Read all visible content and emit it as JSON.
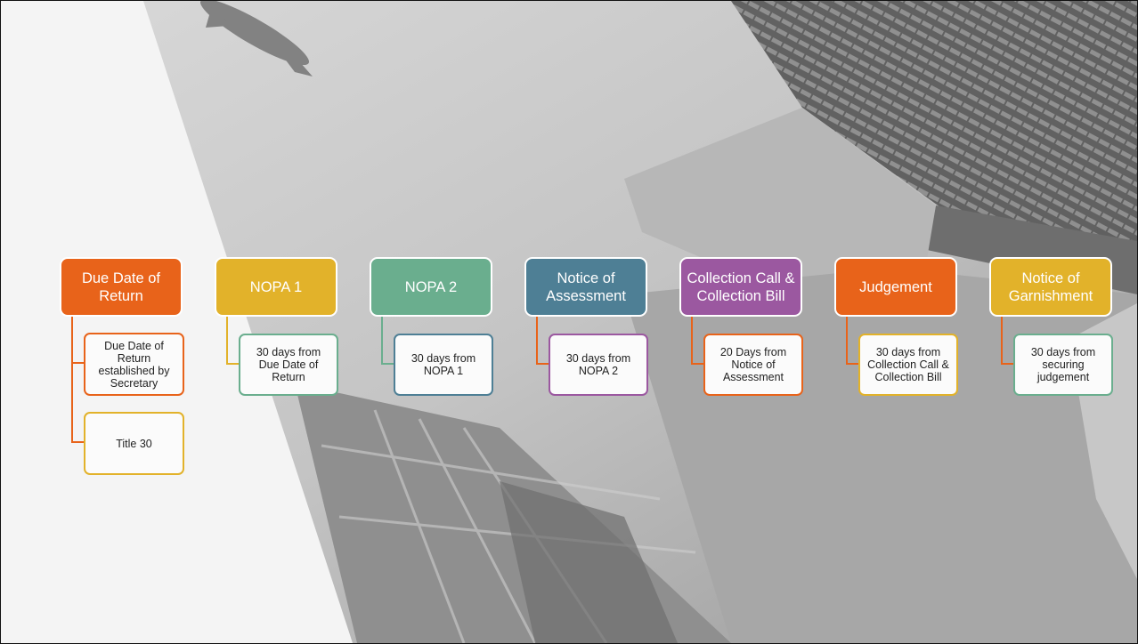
{
  "colors": {
    "orange": "#e8631a",
    "gold": "#e2b22a",
    "teal": "#6aae8e",
    "steel": "#4e7f95",
    "purple": "#9b58a0"
  },
  "steps": [
    {
      "title": "Due Date of Return",
      "color": "#e8631a",
      "lineColor": "#e8631a",
      "children": [
        {
          "text": "Due Date of Return established by Secretary",
          "border": "#e8631a"
        },
        {
          "text": "Title 30",
          "border": "#e2b22a"
        }
      ]
    },
    {
      "title": "NOPA 1",
      "color": "#e2b22a",
      "lineColor": "#e2b22a",
      "children": [
        {
          "text": "30 days from Due Date of Return",
          "border": "#6aae8e"
        }
      ]
    },
    {
      "title": "NOPA 2",
      "color": "#6aae8e",
      "lineColor": "#6aae8e",
      "children": [
        {
          "text": "30 days from NOPA 1",
          "border": "#4e7f95"
        }
      ]
    },
    {
      "title": "Notice of Assessment",
      "color": "#4e7f95",
      "lineColor": "#e8631a",
      "children": [
        {
          "text": "30 days from NOPA 2",
          "border": "#9b58a0"
        }
      ]
    },
    {
      "title": "Collection Call & Collection Bill",
      "color": "#9b58a0",
      "lineColor": "#e8631a",
      "children": [
        {
          "text": "20 Days from Notice of Assessment",
          "border": "#e8631a"
        }
      ]
    },
    {
      "title": "Judgement",
      "color": "#e8631a",
      "lineColor": "#e8631a",
      "children": [
        {
          "text": "30 days from Collection Call & Collection Bill",
          "border": "#e2b22a"
        }
      ]
    },
    {
      "title": "Notice of Garnishment",
      "color": "#e2b22a",
      "lineColor": "#e8631a",
      "children": [
        {
          "text": "30 days from securing judgement",
          "border": "#6aae8e"
        }
      ]
    }
  ]
}
